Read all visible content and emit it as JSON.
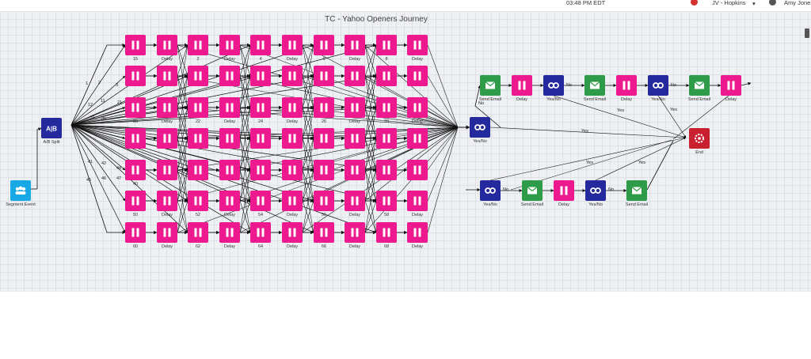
{
  "header": {
    "time": "03:48 PM EDT",
    "account": "JV - Hopkins",
    "user": "Amy Jone"
  },
  "journey": {
    "title": "TC - Yahoo Openers Journey"
  },
  "colors": {
    "delay": "#ec1a8e",
    "send_email": "#2e9b48",
    "yes_no": "#25299e",
    "end": "#c8202f",
    "segment": "#16a9e6",
    "ab_split": "#25299e",
    "edge": "#111111",
    "canvas": "#eef0f3"
  },
  "nodes": {
    "segment": {
      "label": "Segment Event",
      "icon": "segment-people-icon"
    },
    "ab_split": {
      "label": "A/B Split",
      "icon": "ab-split-icon",
      "text": "A|B"
    },
    "yesno_main": {
      "label": "Yes/No",
      "icon": "infinity-icon"
    },
    "end": {
      "label": "End",
      "icon": "end-gear-icon"
    },
    "delay_label": "Delay",
    "grid_rows": [
      {
        "labels": [
          "15",
          "Delay",
          "2",
          "Delay",
          "4",
          "Delay",
          "6",
          "Delay",
          "8",
          "Delay"
        ]
      },
      {
        "labels": [
          "",
          "",
          "",
          "",
          "",
          "",
          "",
          "",
          "",
          ""
        ]
      },
      {
        "labels": [
          "20",
          "Delay",
          "22",
          "Delay",
          "24",
          "Delay",
          "26",
          "Delay",
          "28",
          "Delay"
        ]
      },
      {
        "labels": [
          "",
          "",
          "",
          "",
          "",
          "",
          "",
          "",
          "",
          ""
        ]
      },
      {
        "labels": [
          "40",
          "",
          "",
          "",
          "",
          "",
          "",
          "",
          "",
          ""
        ]
      },
      {
        "labels": [
          "50",
          "Delay",
          "52",
          "Delay",
          "54",
          "Delay",
          "56",
          "Delay",
          "58",
          "Delay"
        ]
      },
      {
        "labels": [
          "60",
          "Delay",
          "62",
          "Delay",
          "64",
          "Delay",
          "66",
          "Delay",
          "68",
          "Delay"
        ]
      }
    ],
    "top_chain": [
      "Send Email",
      "Delay",
      "Yes/No",
      "Send Email",
      "Delay",
      "Yes/No",
      "Send Email",
      "Delay"
    ],
    "bottom_chain": [
      "Yes/No",
      "Send Email",
      "Delay",
      "Yes/No",
      "Send Email"
    ]
  },
  "edge_labels": {
    "split_numbers": [
      "1",
      "2",
      "3",
      "11",
      "12",
      "21",
      "31",
      "32",
      "41",
      "42",
      "44",
      "45",
      "46",
      "47"
    ],
    "no": "No",
    "yes": "Yes"
  }
}
